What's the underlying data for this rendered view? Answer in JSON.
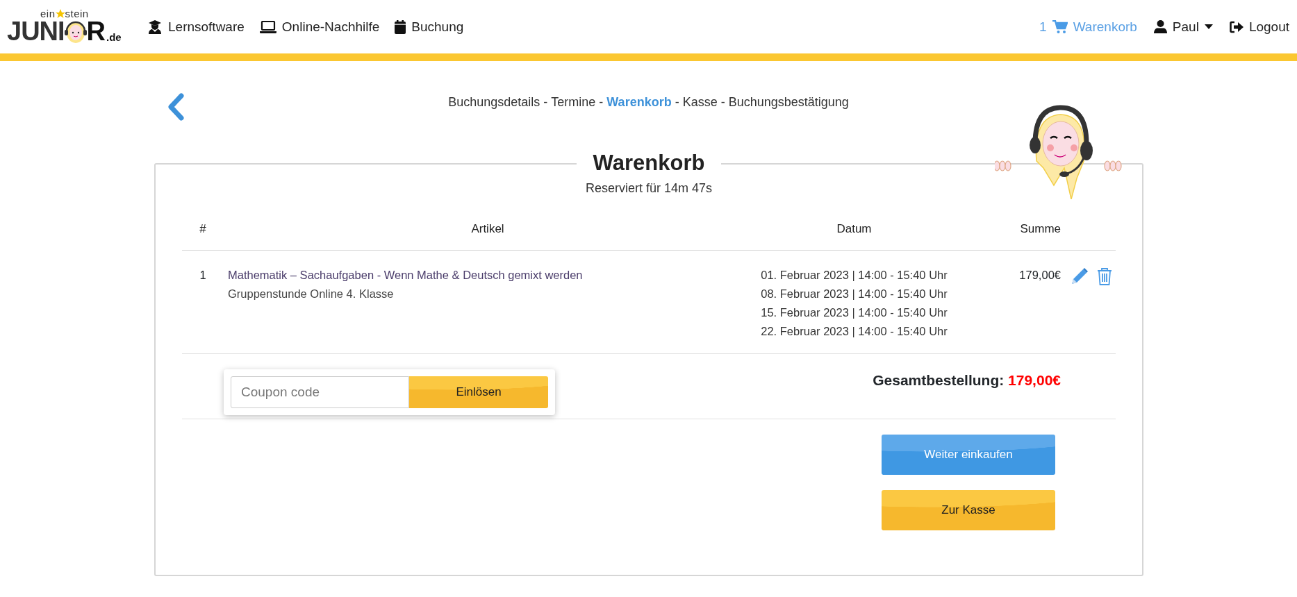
{
  "logo": {
    "top_left": "ein",
    "top_right": "stein",
    "main_left": "JUNI",
    "main_right": "R",
    "suffix": ".de"
  },
  "nav": [
    {
      "label": "Lernsoftware",
      "kind": "software"
    },
    {
      "label": "Online-Nachhilfe",
      "kind": "tutoring"
    },
    {
      "label": "Buchung",
      "kind": "booking"
    }
  ],
  "user_nav": {
    "cart_count": "1",
    "cart_label": "Warenkorb",
    "user": "Paul",
    "logout": "Logout"
  },
  "breadcrumb": {
    "separator": "-",
    "steps": [
      {
        "label": "Buchungsdetails",
        "selected": false
      },
      {
        "label": "Termine",
        "selected": false
      },
      {
        "label": "Warenkorb",
        "selected": true
      },
      {
        "label": "Kasse",
        "selected": false
      },
      {
        "label": "Buchungsbestätigung",
        "selected": false
      }
    ]
  },
  "cart": {
    "title": "Warenkorb",
    "reserved": "Reserviert für 14m 47s",
    "columns": [
      "#",
      "Artikel",
      "Datum",
      "Summe"
    ],
    "rows": [
      {
        "index": "1",
        "article": "Mathematik – Sachaufgaben - Wenn Mathe & Deutsch gemixt werden",
        "subtitle": "Gruppenstunde Online 4. Klasse",
        "dates": [
          "01. Februar 2023 | 14:00 - 15:40 Uhr",
          "08. Februar 2023 | 14:00 - 15:40 Uhr",
          "15. Februar 2023 | 14:00 - 15:40 Uhr",
          "22. Februar 2023 | 14:00 - 15:40 Uhr"
        ],
        "sum": "179,00€"
      }
    ],
    "coupon": {
      "placeholder": "Coupon code",
      "button": "Einlösen"
    },
    "total_label": "Gesamtbestellung:",
    "total_value": "179,00€",
    "buttons": [
      {
        "label": "Weiter einkaufen",
        "kind": "primary"
      },
      {
        "label": "Zur Kasse",
        "kind": "warning"
      }
    ]
  }
}
